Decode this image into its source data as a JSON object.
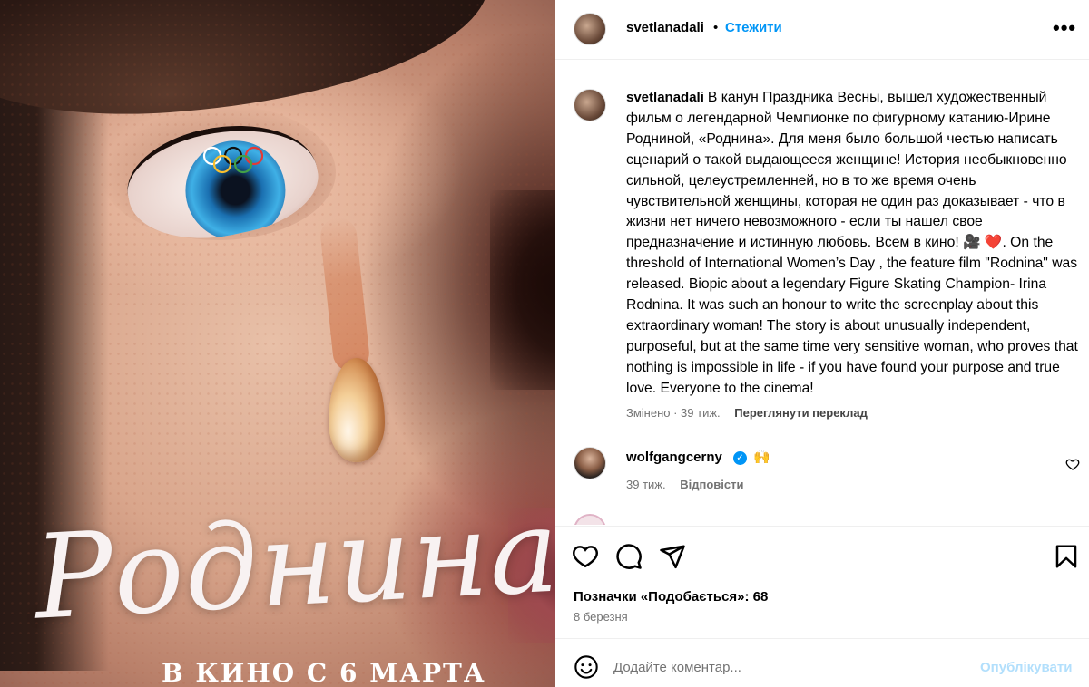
{
  "poster": {
    "title": "Роднина",
    "subtitle": "В КИНО С 6 МАРТА"
  },
  "header": {
    "username": "svetlanadali",
    "separator": "•",
    "follow_label": "Стежити",
    "more_label": "•••"
  },
  "caption": {
    "username": "svetlanadali",
    "text": "В канун Праздника Весны, вышел художественный фильм о легендарной Чемпионке по фигурному катанию-Ирине Родниной, «Роднина». Для меня было большой честью написать сценарий о такой выдающееся женщине! История необыкновенно сильной, целеустремленней, но в то же время очень чувствительной женщины, которая не один раз доказывает - что в жизни нет ничего невозможного - если ты нашел свое предназначение и истинную любовь. Всем в кино! 🎥 ❤️. On the threshold of International Women’s Day , the feature film \"Rodnina\" was released. Biopic about a legendary Figure Skating Champion- Irina Rodnina. It was such an honour to write the screenplay about this extraordinary woman! The story is about unusually independent, purposeful, but at the same time very sensitive woman, who proves that nothing is impossible in life - if you have found your purpose and true love. Everyone to the cinema!",
    "edited_label": "Змінено · 39 тиж.",
    "translation_label": "Переглянути переклад"
  },
  "comment": {
    "username": "wolfgangcerny",
    "verified_mark": "✓",
    "text": "🙌",
    "time": "39 тиж.",
    "reply_label": "Відповісти"
  },
  "partial_comment": {
    "text": "…"
  },
  "actions": {
    "likes_text": "Позначки «Подобається»: 68",
    "date_text": "8 березня"
  },
  "add_comment": {
    "placeholder": "Додайте коментар...",
    "publish_label": "Опублікувати"
  },
  "icons": [
    "heart-icon",
    "comment-icon",
    "share-icon",
    "bookmark-icon",
    "emoji-icon",
    "more-icon",
    "verified-icon"
  ],
  "colors": {
    "link": "#0095f6",
    "publish_disabled": "#b2dffc",
    "meta": "#737373"
  }
}
